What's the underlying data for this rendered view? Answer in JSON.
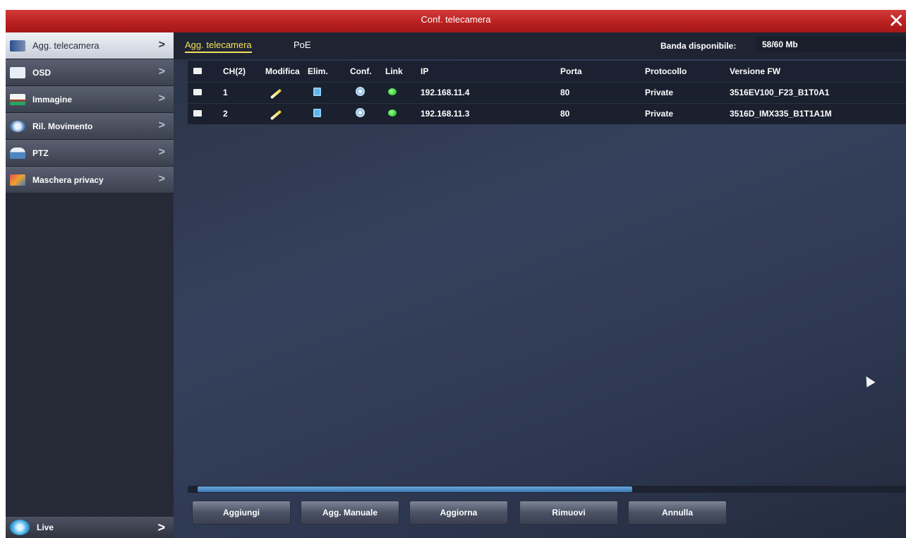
{
  "window": {
    "title": "Conf. telecamera",
    "close_icon": "close-icon"
  },
  "sidebar": {
    "items": [
      {
        "label": "Agg. telecamera",
        "icon": "camera-add-icon",
        "active": true
      },
      {
        "label": "OSD",
        "icon": "osd-icon",
        "active": false
      },
      {
        "label": "Immagine",
        "icon": "image-icon",
        "active": false
      },
      {
        "label": "Ril. Movimento",
        "icon": "motion-icon",
        "active": false
      },
      {
        "label": "PTZ",
        "icon": "ptz-icon",
        "active": false
      },
      {
        "label": "Maschera privacy",
        "icon": "privacy-mask-icon",
        "active": false
      }
    ],
    "live": {
      "label": "Live",
      "icon": "live-icon"
    }
  },
  "tabs": [
    {
      "label": "Agg. telecamera",
      "active": true
    },
    {
      "label": "PoE",
      "active": false
    }
  ],
  "bandwidth": {
    "label": "Banda disponibile:",
    "value": "58/60 Mb"
  },
  "table": {
    "headers": [
      "CH(2)",
      "Modifica",
      "Elim.",
      "Conf.",
      "Link",
      "IP",
      "Porta",
      "Protocollo",
      "Versione FW"
    ],
    "rows": [
      {
        "ch": "1",
        "ip": "192.168.11.4",
        "port": "80",
        "protocol": "Private",
        "fw": "3516EV100_F23_B1T0A1"
      },
      {
        "ch": "2",
        "ip": "192.168.11.3",
        "port": "80",
        "protocol": "Private",
        "fw": "3516D_IMX335_B1T1A1M"
      }
    ]
  },
  "buttons": {
    "add": "Aggiungi",
    "add_manual": "Agg. Manuale",
    "refresh": "Aggiorna",
    "remove": "Rimuovi",
    "cancel": "Annulla"
  },
  "colors": {
    "title_bar": "#c42a2a",
    "active_tab": "#f0e05a",
    "link_ok": "#2ed12a"
  }
}
